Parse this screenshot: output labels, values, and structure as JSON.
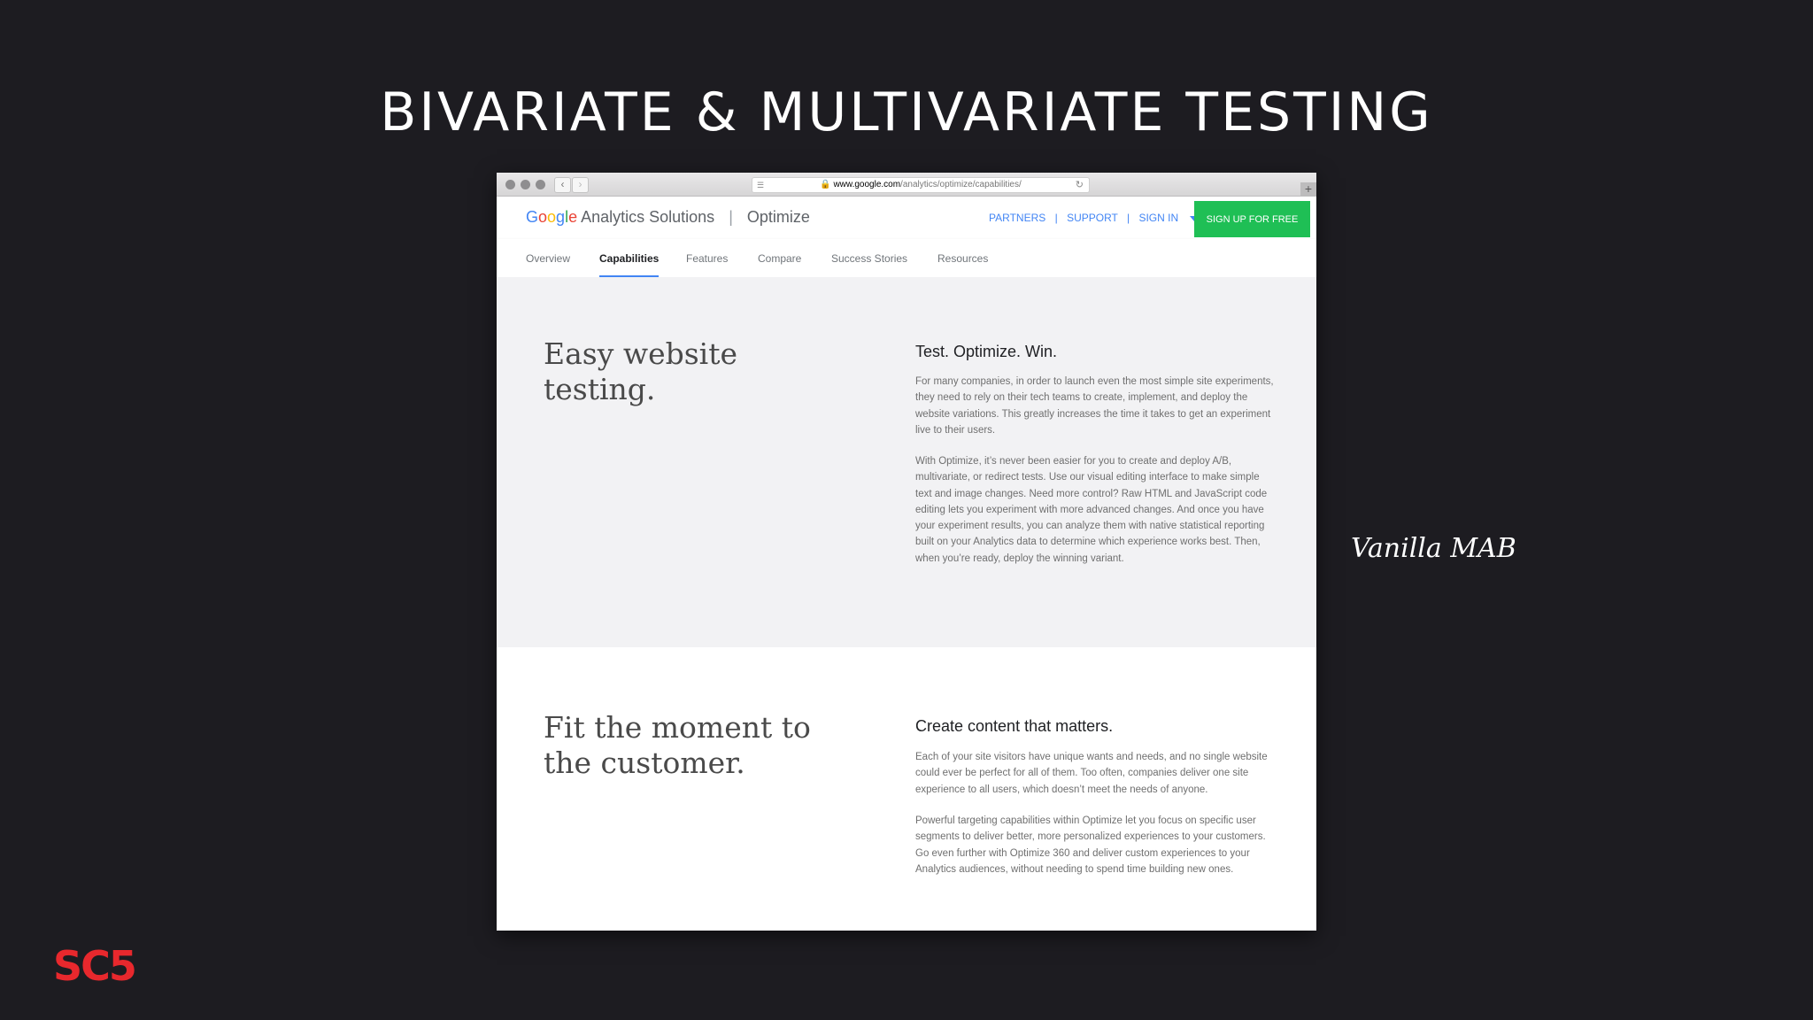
{
  "slide": {
    "title": "BIVARIATE & MULTIVARIATE TESTING",
    "caption": "Vanilla MAB",
    "logo": "SC5"
  },
  "browser": {
    "back_icon": "‹",
    "forward_icon": "›",
    "url_domain": "www.google.com",
    "url_path": "/analytics/optimize/capabilities/",
    "new_tab_icon": "+"
  },
  "site": {
    "brand_g": [
      "G",
      "o",
      "o",
      "g",
      "l",
      "e"
    ],
    "brand_suffix": "Analytics Solutions",
    "brand_product": "Optimize",
    "header_links": [
      "PARTNERS",
      "SUPPORT",
      "SIGN IN"
    ],
    "signup_label": "SIGN UP FOR FREE",
    "tabs": [
      "Overview",
      "Capabilities",
      "Features",
      "Compare",
      "Success Stories",
      "Resources"
    ],
    "active_tab": "Capabilities"
  },
  "sections": [
    {
      "heading": "Easy website testing.",
      "subheading": "Test. Optimize. Win.",
      "paragraphs": [
        "For many companies, in order to launch even the most simple site experiments, they need to rely on their tech teams to create, implement, and deploy the website variations. This greatly increases the time it takes to get an experiment live to their users.",
        "With Optimize, it’s never been easier for you to create and deploy A/B, multivariate, or redirect tests. Use our visual editing interface to make simple text and image changes. Need more control? Raw HTML and JavaScript code editing lets you experiment with more advanced changes. And once you have your experiment results, you can analyze them with native statistical reporting built on your Analytics data to determine which experience works best. Then, when you’re ready, deploy the winning variant."
      ]
    },
    {
      "heading": "Fit the moment to the customer.",
      "subheading": "Create content that matters.",
      "paragraphs": [
        "Each of your site visitors have unique wants and needs, and no single website could ever be perfect for all of them. Too often, companies deliver one site experience to all users, which doesn’t meet the needs of anyone.",
        "Powerful targeting capabilities within Optimize let you focus on specific user segments to deliver better, more personalized experiences to your customers. Go even further with Optimize 360 and deliver custom experiences to your Analytics audiences, without needing to spend time building new ones."
      ]
    }
  ]
}
